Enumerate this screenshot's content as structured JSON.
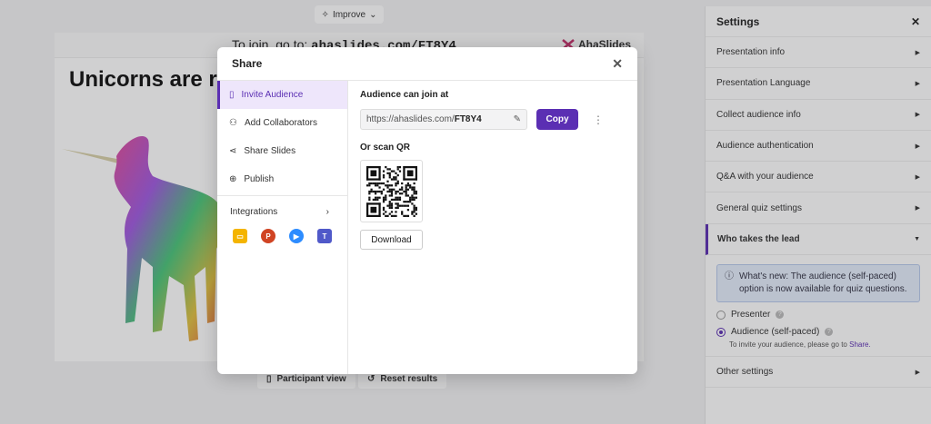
{
  "toolbar": {
    "improve_label": "Improve"
  },
  "slide": {
    "join_prefix": "To join, go to:",
    "join_url": "ahaslides.com/FT8Y4",
    "brand": "AhaSlides",
    "title": "Unicorns are re"
  },
  "bottom": {
    "participant_view": "Participant view",
    "reset_results": "Reset results"
  },
  "settings": {
    "title": "Settings",
    "rows": [
      "Presentation info",
      "Presentation Language",
      "Collect audience info",
      "Audience authentication",
      "Q&A with your audience",
      "General quiz settings"
    ],
    "active_row": "Who takes the lead",
    "info_text": "What's new: The audience (self-paced) option is now available for quiz questions.",
    "option_presenter": "Presenter",
    "option_audience": "Audience (self-paced)",
    "hint_prefix": "To invite your audience, please go to",
    "hint_link": "Share.",
    "other_settings": "Other settings"
  },
  "modal": {
    "title": "Share",
    "nav": [
      {
        "label": "Invite Audience"
      },
      {
        "label": "Add Collaborators"
      },
      {
        "label": "Share Slides"
      },
      {
        "label": "Publish"
      }
    ],
    "integrations_label": "Integrations",
    "join_label": "Audience can join at",
    "url_prefix": "https://ahaslides.com/",
    "url_code": "FT8Y4",
    "copy_label": "Copy",
    "qr_label": "Or scan QR",
    "download_label": "Download"
  },
  "colors": {
    "accent": "#5b2fb3",
    "info_bg": "#e4edfb"
  }
}
